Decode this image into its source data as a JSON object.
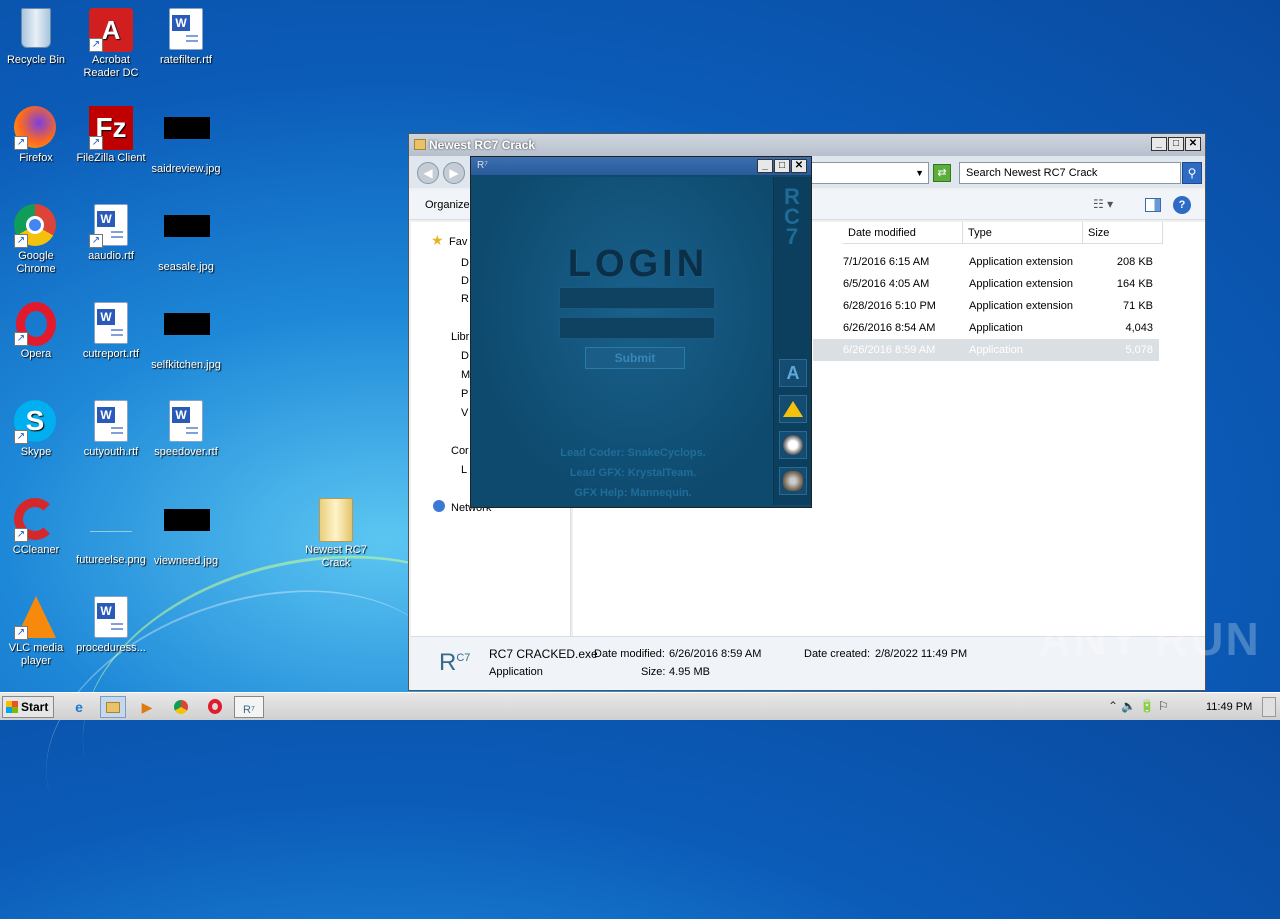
{
  "desktop_icons": [
    {
      "label": "Recycle Bin"
    },
    {
      "label": "Acrobat Reader DC"
    },
    {
      "label": "ratefilter.rtf"
    },
    {
      "label": "Firefox"
    },
    {
      "label": "FileZilla Client"
    },
    {
      "label": "saidreview.jpg"
    },
    {
      "label": "Google Chrome"
    },
    {
      "label": "aaudio.rtf"
    },
    {
      "label": "seasale.jpg"
    },
    {
      "label": "Opera"
    },
    {
      "label": "cutreport.rtf"
    },
    {
      "label": "selfkitchen.jpg"
    },
    {
      "label": "Skype"
    },
    {
      "label": "cutyouth.rtf"
    },
    {
      "label": "speedover.rtf"
    },
    {
      "label": "CCleaner"
    },
    {
      "label": "futureelse.png"
    },
    {
      "label": "viewneed.jpg"
    },
    {
      "label": "Newest RC7 Crack"
    },
    {
      "label": "VLC media player"
    },
    {
      "label": "proceduress..."
    }
  ],
  "explorer": {
    "title": "Newest RC7 Crack",
    "search_placeholder": "Search Newest RC7 Crack",
    "organize": "Organize",
    "columns": {
      "date": "Date modified",
      "type": "Type",
      "size": "Size"
    },
    "nav": [
      "Fav",
      "D",
      "D",
      "R",
      "Libr",
      "D",
      "M",
      "P",
      "V",
      "Cor",
      "L",
      "Network"
    ],
    "rows": [
      {
        "date": "7/1/2016 6:15 AM",
        "type": "Application extension",
        "size": "208 KB"
      },
      {
        "date": "6/5/2016 4:05 AM",
        "type": "Application extension",
        "size": "164 KB"
      },
      {
        "date": "6/28/2016 5:10 PM",
        "type": "Application extension",
        "size": "71 KB"
      },
      {
        "date": "6/26/2016 8:54 AM",
        "type": "Application",
        "size": "4,043 KB"
      },
      {
        "date": "6/26/2016 8:59 AM",
        "type": "Application",
        "size": "5,078 KB"
      }
    ],
    "details": {
      "name": "RC7 CRACKED.exe",
      "modified_label": "Date modified:",
      "modified": "6/26/2016 8:59 AM",
      "created_label": "Date created:",
      "created": "2/8/2022 11:49 PM",
      "kind": "Application",
      "size_label": "Size:",
      "size": "4.95 MB"
    }
  },
  "rc7": {
    "bar_title": "R⁷",
    "side_logo": "RC7",
    "heading": "LOGIN",
    "submit": "Submit",
    "credits": [
      "Lead Coder: SnakeCyclops.",
      "Lead GFX: KrystalTeam.",
      "GFX Help: Mannequin."
    ]
  },
  "taskbar": {
    "start": "Start",
    "clock": "11:49 PM"
  },
  "watermark": "ANY RUN"
}
